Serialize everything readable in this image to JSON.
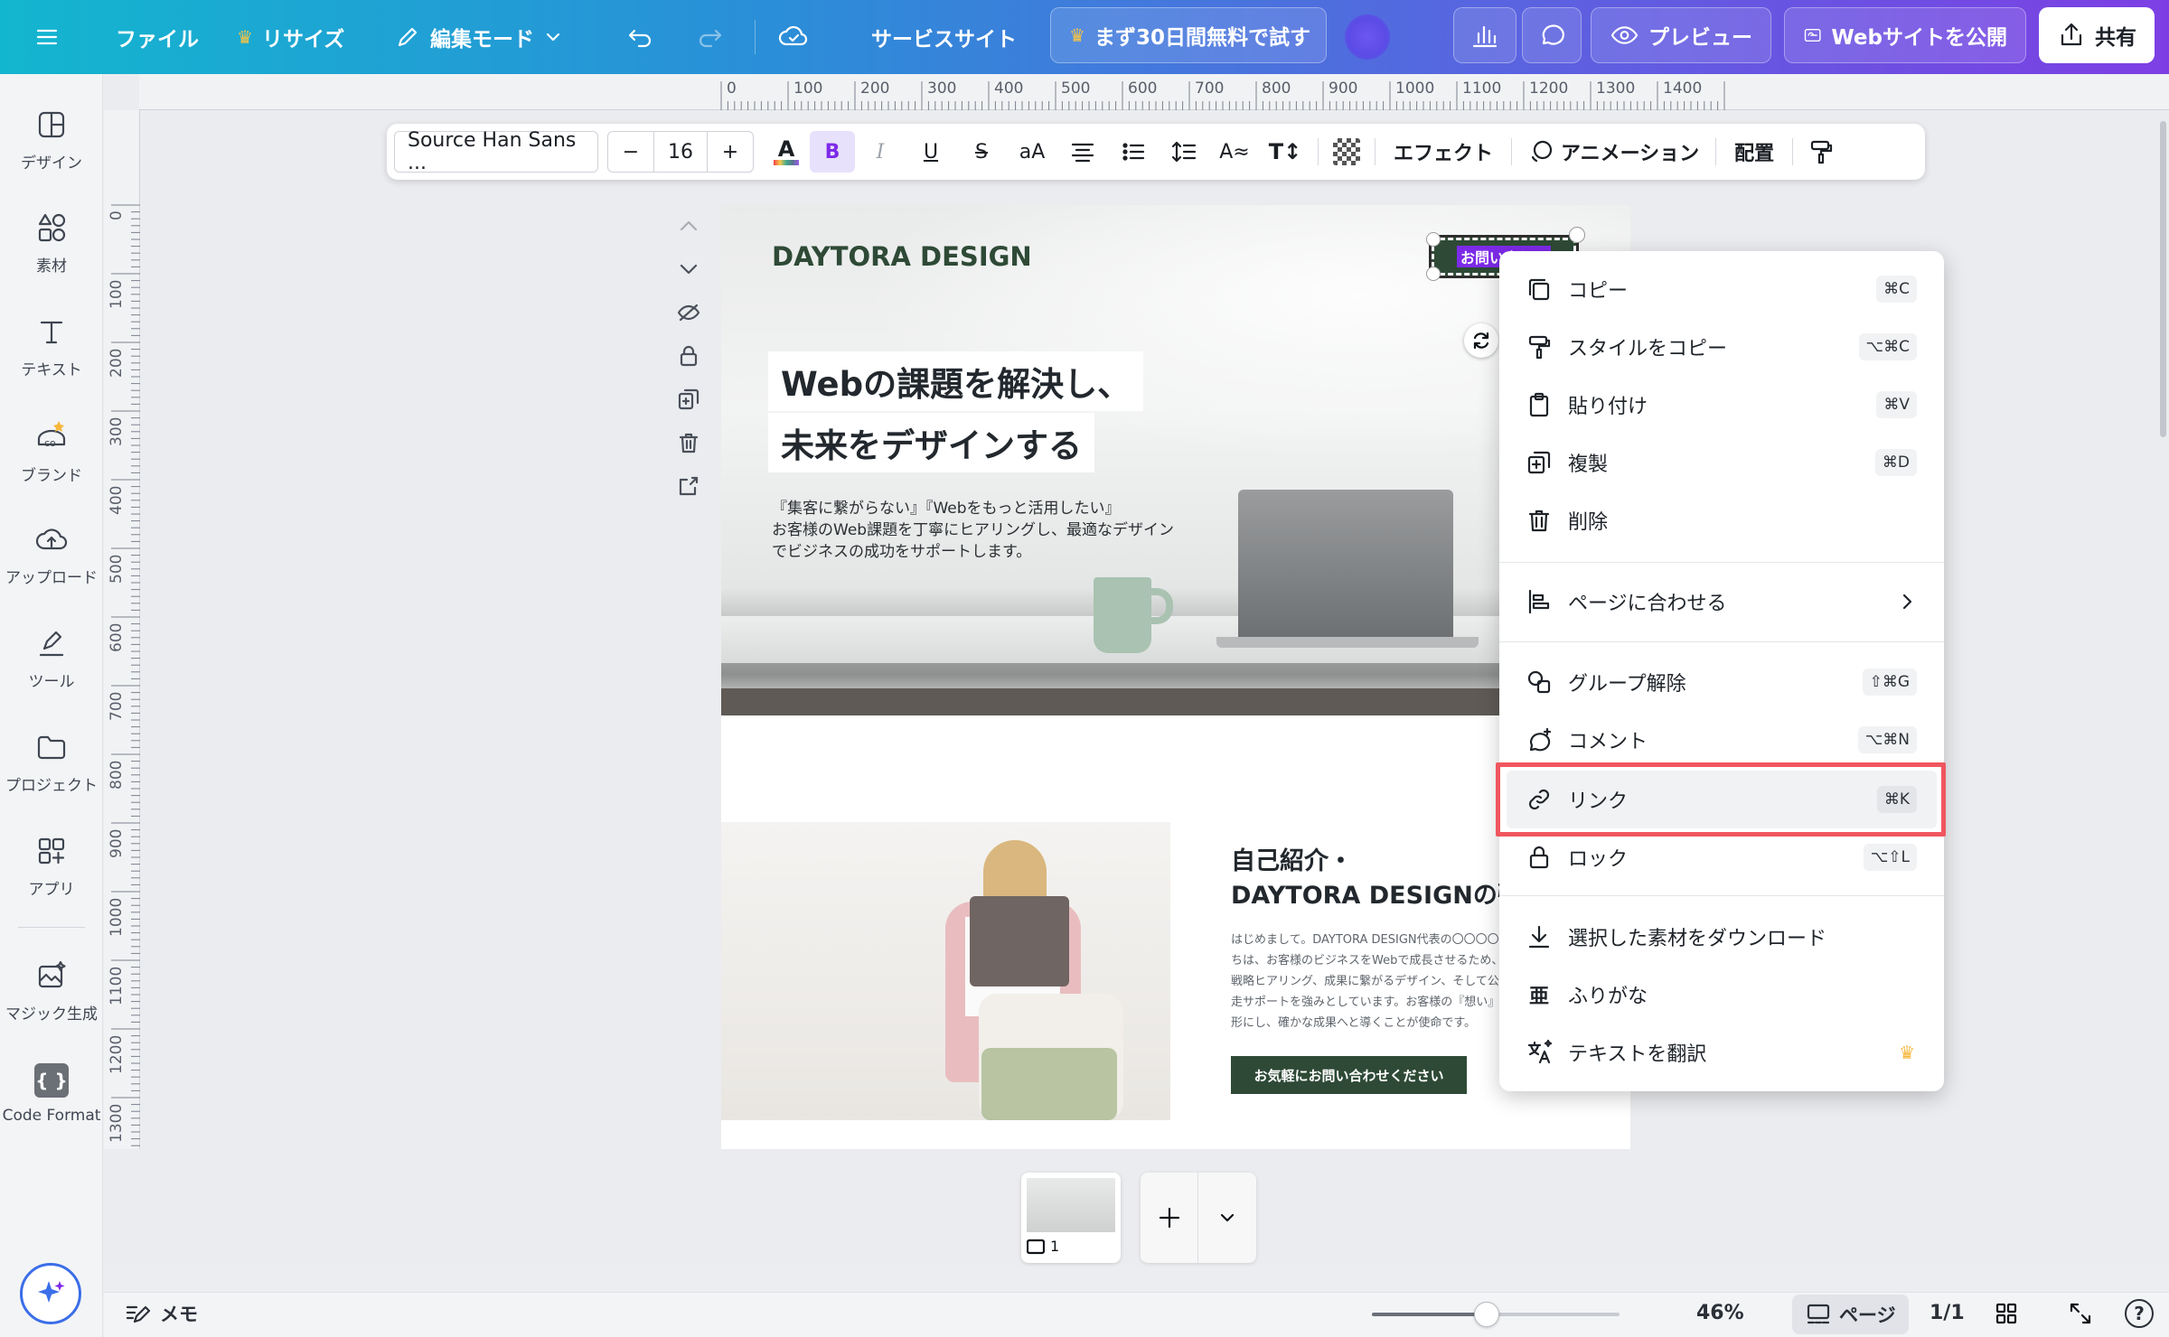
{
  "topbar": {
    "file": "ファイル",
    "resize": "リサイズ",
    "edit_mode": "編集モード",
    "service_site": "サービスサイト",
    "trial": "まず30日間無料で試す",
    "preview": "プレビュー",
    "publish": "Webサイトを公開",
    "share": "共有"
  },
  "rail": {
    "items": [
      {
        "label": "デザイン",
        "icon": "layout-icon"
      },
      {
        "label": "素材",
        "icon": "elements-icon"
      },
      {
        "label": "テキスト",
        "icon": "text-icon"
      },
      {
        "label": "ブランド",
        "icon": "brand-icon"
      },
      {
        "label": "アップロード",
        "icon": "upload-cloud-icon"
      },
      {
        "label": "ツール",
        "icon": "draw-icon"
      },
      {
        "label": "プロジェクト",
        "icon": "folder-icon"
      },
      {
        "label": "アプリ",
        "icon": "apps-icon"
      },
      {
        "label": "マジック生成",
        "icon": "magic-media-icon"
      },
      {
        "label": "Code Format",
        "icon": "code-icon"
      }
    ]
  },
  "ruler": {
    "h": [
      "0",
      "100",
      "200",
      "300",
      "400",
      "500",
      "600",
      "700",
      "800",
      "900",
      "1000",
      "1100",
      "1200",
      "1300",
      "1400"
    ],
    "v": [
      "0",
      "100",
      "200",
      "300",
      "400",
      "500",
      "600",
      "700",
      "800",
      "900",
      "1000",
      "1100",
      "1200",
      "1300"
    ]
  },
  "toolbar": {
    "font": "Source Han Sans ...",
    "font_size": "16",
    "effects": "エフェクト",
    "animation": "アニメーション",
    "position": "配置"
  },
  "page": {
    "brand": "DAYTORA DESIGN",
    "contact_button": "お問い合わせ",
    "headline_1": "Webの課題を解決し、",
    "headline_2": "未来をデザインする",
    "body_lines": [
      "『集客に繋がらない』『Webをもっと活用したい』",
      "お客様のWeb課題を丁寧にヒアリングし、最適なデザイン",
      "でビジネスの成功をサポートします。"
    ],
    "about_title_1": "自己紹介・",
    "about_title_2": "DAYTORA DESIGNの強み",
    "about_lines": [
      "はじめまして。DAYTORA DESIGN代表の〇〇〇〇で",
      "ちは、お客様のビジネスをWebで成長させるため、",
      "戦略ヒアリング、成果に繋がるデザイン、そして公",
      "走サポートを強みとしています。お客様の『想い』",
      "形にし、確かな成果へと導くことが使命です。"
    ],
    "cta": "お気軽にお問い合わせください"
  },
  "context_menu": {
    "items": [
      {
        "label": "コピー",
        "shortcut": "⌘C"
      },
      {
        "label": "スタイルをコピー",
        "shortcut": "⌥⌘C"
      },
      {
        "label": "貼り付け",
        "shortcut": "⌘V"
      },
      {
        "label": "複製",
        "shortcut": "⌘D"
      },
      {
        "label": "削除",
        "shortcut": ""
      },
      {
        "label": "ページに合わせる",
        "shortcut": ""
      },
      {
        "label": "グループ解除",
        "shortcut": "⇧⌘G"
      },
      {
        "label": "コメント",
        "shortcut": "⌥⌘N"
      },
      {
        "label": "リンク",
        "shortcut": "⌘K"
      },
      {
        "label": "ロック",
        "shortcut": "⌥⇧L"
      },
      {
        "label": "選択した素材をダウンロード",
        "shortcut": ""
      },
      {
        "label": "ふりがな",
        "shortcut": ""
      },
      {
        "label": "テキストを翻訳",
        "shortcut": ""
      }
    ],
    "highlight_color": "#f0565e"
  },
  "bottom": {
    "notes": "メモ",
    "zoom": "46%",
    "pages": "ページ",
    "page_count": "1/1",
    "thumb_number": "1"
  },
  "colors": {
    "accent": "#7d2ae8",
    "brand_green": "#2e4a36"
  }
}
